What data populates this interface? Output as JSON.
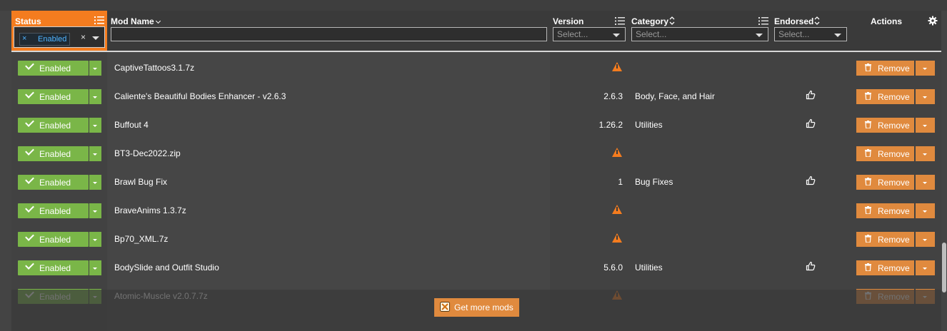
{
  "header": {
    "status_label": "Status",
    "status_filter_tag": "Enabled",
    "status_filter_tag_remove": "×",
    "status_filter_clear": "×",
    "name_label": "Mod Name",
    "version_label": "Version",
    "category_label": "Category",
    "endorsed_label": "Endorsed",
    "actions_label": "Actions",
    "version_placeholder": "Select...",
    "category_placeholder": "Select...",
    "endorsed_placeholder": "Select...",
    "name_filter_value": ""
  },
  "rows": [
    {
      "status": "Enabled",
      "name": "CaptiveTattoos3.1.7z",
      "version": "",
      "warn": true,
      "category": "",
      "endorsed": false,
      "action": "Remove"
    },
    {
      "status": "Enabled",
      "name": "Caliente's Beautiful Bodies Enhancer - v2.6.3",
      "version": "2.6.3",
      "warn": false,
      "category": "Body, Face, and Hair",
      "endorsed": true,
      "action": "Remove"
    },
    {
      "status": "Enabled",
      "name": "Buffout 4",
      "version": "1.26.2",
      "warn": false,
      "category": "Utilities",
      "endorsed": true,
      "action": "Remove"
    },
    {
      "status": "Enabled",
      "name": "BT3-Dec2022.zip",
      "version": "",
      "warn": true,
      "category": "",
      "endorsed": false,
      "action": "Remove"
    },
    {
      "status": "Enabled",
      "name": "Brawl Bug Fix",
      "version": "1",
      "warn": false,
      "category": "Bug Fixes",
      "endorsed": true,
      "action": "Remove"
    },
    {
      "status": "Enabled",
      "name": "BraveAnims 1.3.7z",
      "version": "",
      "warn": true,
      "category": "",
      "endorsed": false,
      "action": "Remove"
    },
    {
      "status": "Enabled",
      "name": "Bp70_XML.7z",
      "version": "",
      "warn": true,
      "category": "",
      "endorsed": false,
      "action": "Remove"
    },
    {
      "status": "Enabled",
      "name": "BodySlide and Outfit Studio",
      "version": "5.6.0",
      "warn": false,
      "category": "Utilities",
      "endorsed": true,
      "action": "Remove"
    },
    {
      "status": "Enabled",
      "name": "Atomic-Muscle v2.0.7.7z",
      "version": "",
      "warn": true,
      "category": "",
      "endorsed": false,
      "action": "Remove"
    }
  ],
  "footer": {
    "get_more_mods": "Get more mods"
  },
  "colors": {
    "accent": "#f47c1f",
    "enabled": "#7ab648",
    "remove": "#e08a3e"
  }
}
